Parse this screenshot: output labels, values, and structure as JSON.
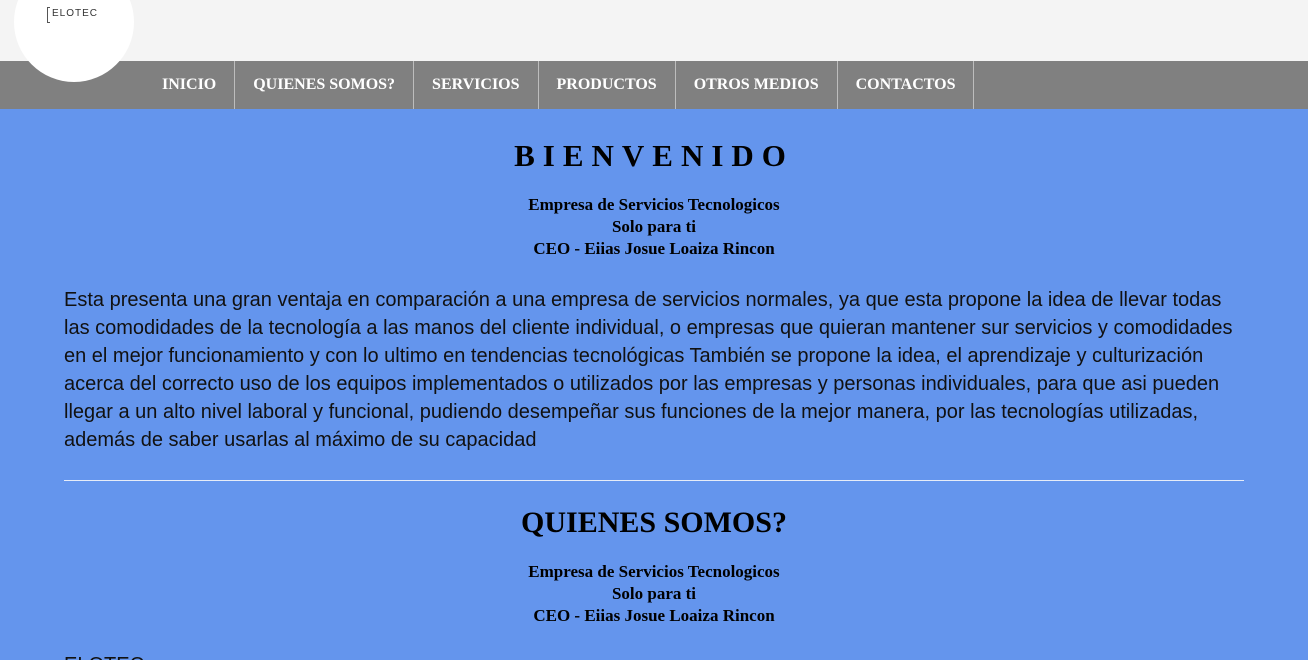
{
  "logo": {
    "text": "ELOTEC"
  },
  "nav": {
    "items": [
      "INICIO",
      "QUIENES SOMOS?",
      "SERVICIOS",
      "PRODUCTOS",
      "OTROS MEDIOS",
      "CONTACTOS"
    ]
  },
  "welcome": {
    "title": "BIENVENIDO",
    "line1": "Empresa de Servicios Tecnologicos",
    "line2": "Solo para ti",
    "line3": "CEO - Eiias Josue Loaiza Rincon",
    "paragraph": "Esta presenta una gran ventaja en comparación a una empresa de servicios normales, ya que esta propone la idea de llevar todas las comodidades de la tecnología a las manos del cliente individual, o empresas que quieran mantener sur servicios y comodidades en el mejor funcionamiento y con lo ultimo en tendencias tecnológicas También se propone la idea, el aprendizaje y culturización acerca del correcto uso de los equipos implementados o utilizados por las empresas y personas individuales, para que asi pueden llegar a un alto nivel laboral y funcional, pudiendo desempeñar sus funciones de la mejor manera, por las tecnologías utilizadas, además de saber usarlas al máximo de su capacidad"
  },
  "about": {
    "title": "QUIENES SOMOS?",
    "line1": "Empresa de Servicios Tecnologicos",
    "line2": "Solo para ti",
    "line3": "CEO - Eiias Josue Loaiza Rincon",
    "paragraph_start": "ELOTEC"
  }
}
